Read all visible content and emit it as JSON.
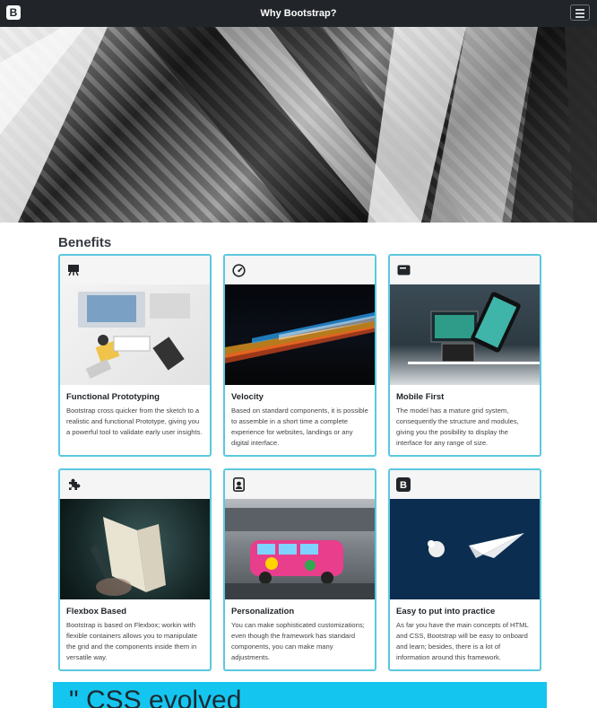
{
  "navbar": {
    "brand_letter": "B",
    "title": "Why Bootstrap?"
  },
  "hero": {
    "image": "black-and-white-architecture-photo"
  },
  "benefits": {
    "heading": "Benefits",
    "cards": [
      {
        "icon": "presentation-easel-icon",
        "image": "workspace-desk-photo",
        "title": "Functional Prototyping",
        "text": "Bootstrap cross quicker from the sketch to a realistic and functional Prototype, giving you a powerful tool to validate early user insights."
      },
      {
        "icon": "speedometer-icon",
        "image": "light-trails-photo",
        "title": "Velocity",
        "text": "Based on standard components, it is possible to assemble in a short time a complete experience for websites, landings or any digital interface."
      },
      {
        "icon": "display-icon",
        "image": "devices-photo",
        "title": "Mobile First",
        "text": "The model has a mature grid system, consequently the structure and modules, giving you the posibility to display the interface for any range of size."
      },
      {
        "icon": "puzzle-piece-icon",
        "image": "open-book-photo",
        "title": "Flexbox Based",
        "text": "Bootstrap is based on Flexbox; workin with flexible containers allows you to manipulate the grid and the components inside them in versatile way."
      },
      {
        "icon": "person-badge-icon",
        "image": "painted-van-photo",
        "title": "Personalization",
        "text": "You can make sophisticated customizations; even though the framework has standard components, you can make many adjustments."
      },
      {
        "icon": "bootstrap-logo-icon",
        "image": "paper-plane-photo",
        "title": "Easy to put into practice",
        "text": "As far you have the main concepts of HTML and CSS, Bootstrap will be easy to onboard and learn; besides, there is a lot of information around this framework."
      }
    ]
  },
  "quote": {
    "text": "\" CSS evolved"
  },
  "colors": {
    "navbar_bg": "#212529",
    "card_border": "#5bc8de",
    "quote_band": "#14c6ef"
  }
}
